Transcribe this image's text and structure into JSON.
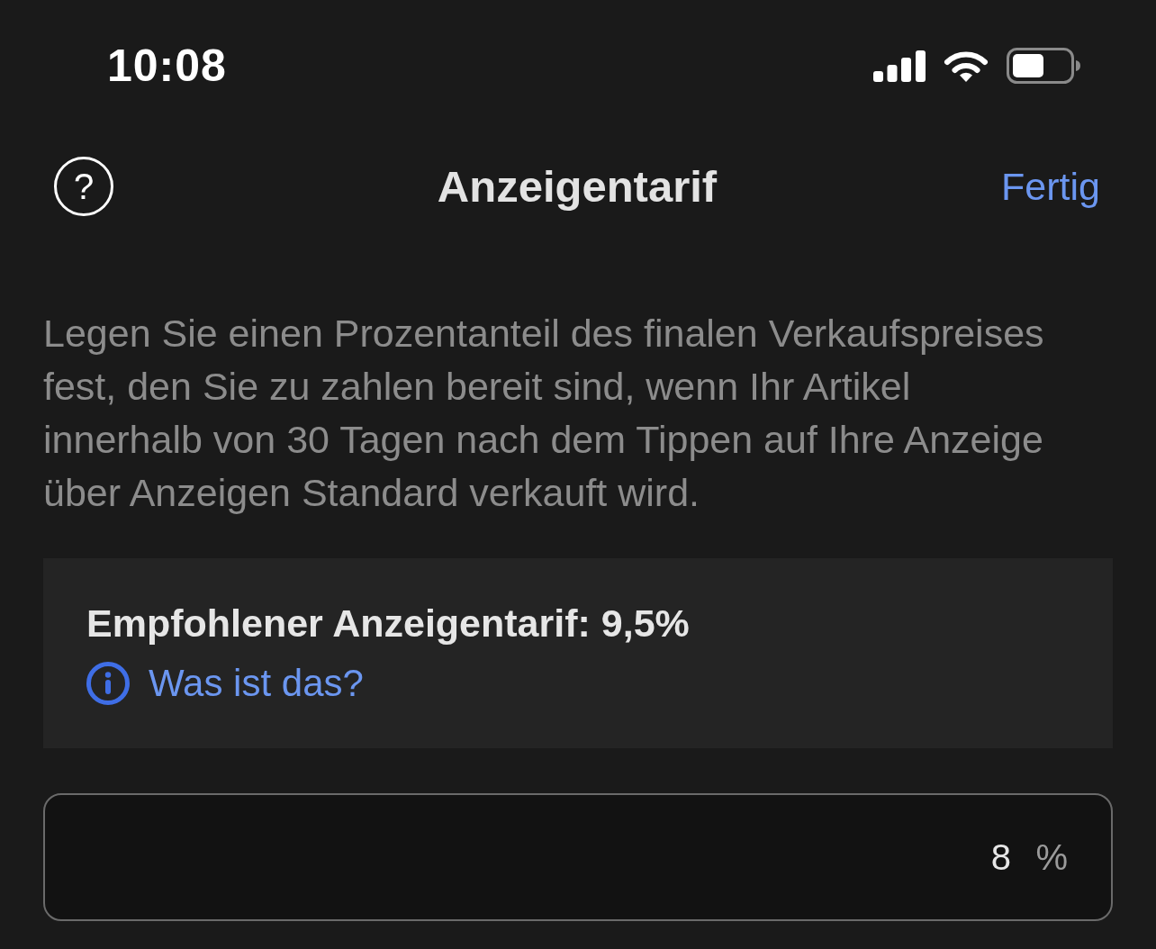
{
  "status_bar": {
    "time": "10:08"
  },
  "nav": {
    "help": "?",
    "title": "Anzeigentarif",
    "done": "Fertig"
  },
  "description": "Legen Sie einen Prozentanteil des finalen Verkaufspreises fest, den Sie zu zahlen bereit sind, wenn Ihr Artikel innerhalb von 30 Tagen nach dem Tippen auf Ihre Anzeige über Anzeigen Standard verkauft wird.",
  "recommendation": {
    "title": "Empfohlener Anzeigentarif: 9,5%",
    "link": "Was ist das?"
  },
  "rate_field": {
    "value": "8",
    "suffix": "%"
  }
}
